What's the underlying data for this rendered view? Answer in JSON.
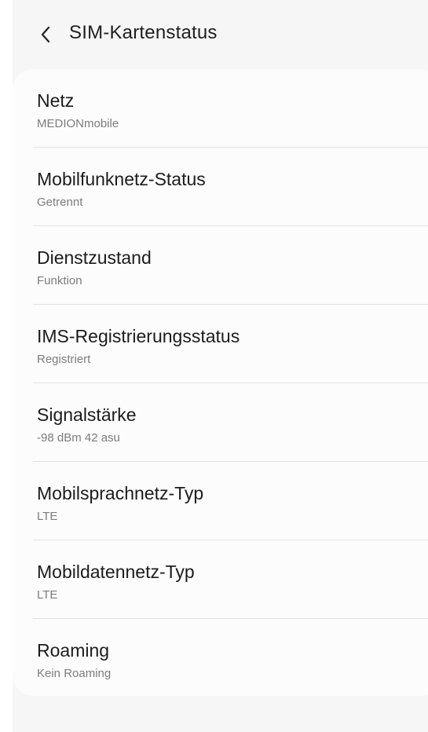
{
  "header": {
    "title": "SIM-Kartenstatus"
  },
  "items": [
    {
      "label": "Netz",
      "value": "MEDIONmobile"
    },
    {
      "label": "Mobilfunknetz-Status",
      "value": "Getrennt"
    },
    {
      "label": "Dienstzustand",
      "value": "Funktion"
    },
    {
      "label": "IMS-Registrierungsstatus",
      "value": "Registriert"
    },
    {
      "label": "Signalstärke",
      "value": "-98 dBm 42 asu"
    },
    {
      "label": "Mobilsprachnetz-Typ",
      "value": "LTE"
    },
    {
      "label": "Mobildatennetz-Typ",
      "value": "LTE"
    },
    {
      "label": "Roaming",
      "value": "Kein Roaming"
    }
  ],
  "icons": {
    "back": "chevron-left-icon"
  },
  "colors": {
    "background": "#f6f6f6",
    "card": "#fcfcfc",
    "primary_text": "#1c1c1c",
    "secondary_text": "#7c7c7c",
    "divider": "#e3e3e3"
  }
}
